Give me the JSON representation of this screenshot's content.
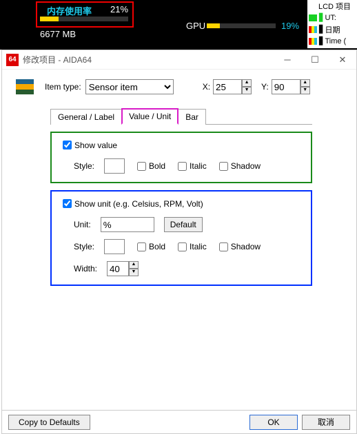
{
  "lcd": {
    "mem_label": "内存使用率",
    "mem_pct": "21%",
    "mem_total": "6677 MB",
    "gpu_label": "GPU",
    "gpu_pct": "19%",
    "legend": {
      "head": "LCD 项目",
      "ut": "UT:",
      "date": "日期",
      "time": "Time ("
    }
  },
  "window": {
    "title": "修改项目 - AIDA64",
    "item_type_label": "Item type:",
    "item_type_value": "Sensor item",
    "x_label": "X:",
    "x_value": "25",
    "y_label": "Y:",
    "y_value": "90",
    "tabs": [
      "General / Label",
      "Value / Unit",
      "Bar"
    ],
    "show_value": "Show value",
    "show_unit": "Show unit (e.g. Celsius, RPM, Volt)",
    "style_label": "Style:",
    "bold": "Bold",
    "italic": "Italic",
    "shadow": "Shadow",
    "unit_label": "Unit:",
    "unit_value": "%",
    "default_btn": "Default",
    "width_label": "Width:",
    "width_value": "40",
    "copy_defaults": "Copy to Defaults",
    "ok": "OK",
    "cancel": "取消"
  }
}
